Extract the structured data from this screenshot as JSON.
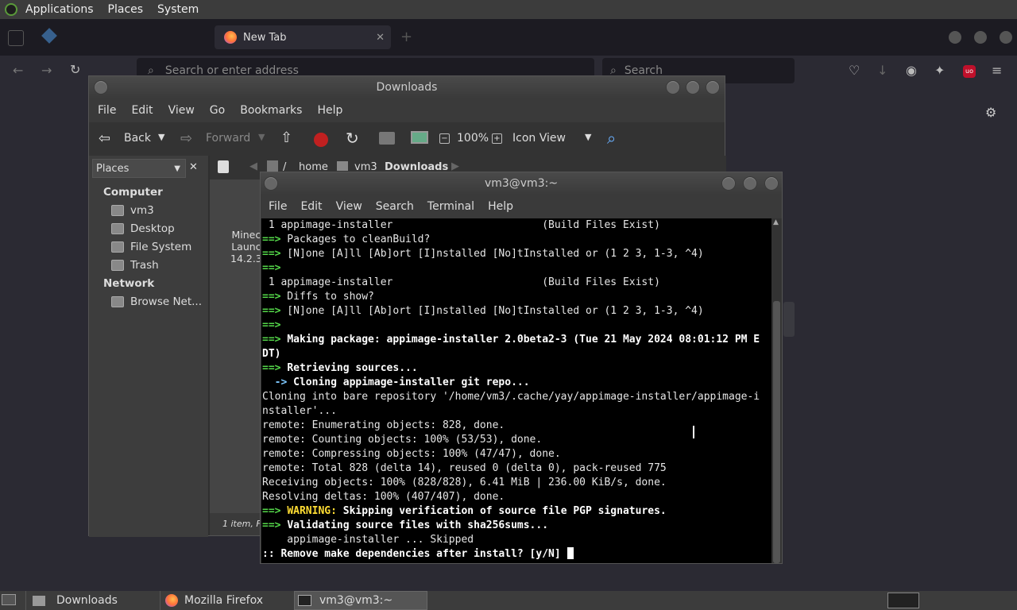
{
  "top_panel": {
    "menus": [
      "Applications",
      "Places",
      "System"
    ]
  },
  "firefox": {
    "tabs": [
      {
        "label": "New Tab"
      }
    ],
    "url_placeholder": "Search or enter address",
    "search_placeholder": "Search",
    "ublock_badge": "uo"
  },
  "nautilus": {
    "title": "Downloads",
    "menu": [
      "File",
      "Edit",
      "View",
      "Go",
      "Bookmarks",
      "Help"
    ],
    "toolbar": {
      "back": "Back",
      "forward": "Forward",
      "zoom": "100%",
      "view_mode": "Icon View"
    },
    "side_select": "Places",
    "path": [
      "/",
      "home",
      "vm3",
      "Downloads"
    ],
    "places": {
      "computer_header": "Computer",
      "computer_items": [
        "vm3",
        "Desktop",
        "File System",
        "Trash"
      ],
      "network_header": "Network",
      "network_items": [
        "Browse Net..."
      ]
    },
    "file_label": [
      "Minec",
      "Launc",
      "14.2.3"
    ],
    "status": "1 item, Fr"
  },
  "terminal": {
    "title": "vm3@vm3:~",
    "menu": [
      "File",
      "Edit",
      "View",
      "Search",
      "Terminal",
      "Help"
    ]
  },
  "taskbar": {
    "items": [
      "Downloads",
      "Mozilla Firefox",
      "vm3@vm3:~"
    ]
  }
}
